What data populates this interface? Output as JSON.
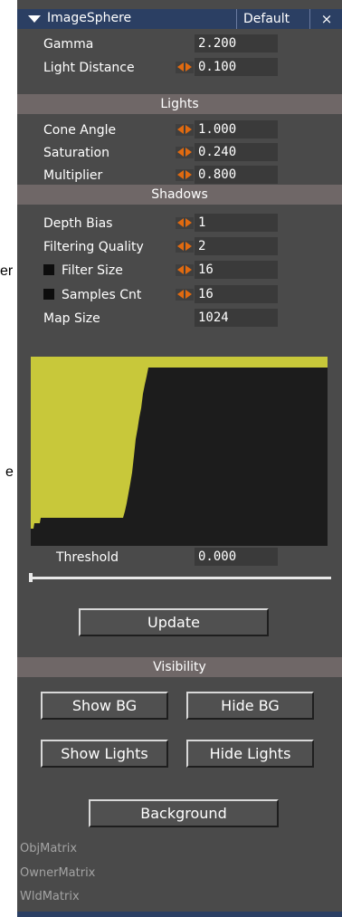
{
  "edge_text": {
    "top": "er",
    "middle": "e"
  },
  "panel": {
    "title": "ImageSphere",
    "preset": "Default",
    "close": "×"
  },
  "params": {
    "gamma": {
      "label": "Gamma",
      "value": "2.200"
    },
    "light_distance": {
      "label": "Light Distance",
      "value": "0.100"
    }
  },
  "lights": {
    "header": "Lights",
    "cone_angle": {
      "label": "Cone Angle",
      "value": "1.000"
    },
    "saturation": {
      "label": "Saturation",
      "value": "0.240"
    },
    "multiplier": {
      "label": "Multiplier",
      "value": "0.800"
    }
  },
  "shadows": {
    "header": "Shadows",
    "depth_bias": {
      "label": "Depth Bias",
      "value": "1"
    },
    "filtering_quality": {
      "label": "Filtering Quality",
      "value": "2"
    },
    "filter_size": {
      "label": "Filter Size",
      "value": "16"
    },
    "samples_cnt": {
      "label": "Samples Cnt",
      "value": "16"
    },
    "map_size": {
      "label": "Map Size",
      "value": "1024"
    }
  },
  "threshold": {
    "label": "Threshold",
    "value": "0.000",
    "slider_fraction": 0
  },
  "buttons": {
    "update": "Update",
    "show_bg": "Show BG",
    "hide_bg": "Hide BG",
    "show_lights": "Show Lights",
    "hide_lights": "Hide Lights",
    "background": "Background"
  },
  "visibility": {
    "header": "Visibility"
  },
  "matrices": [
    "ObjMatrix",
    "OwnerMatrix",
    "WldMatrix"
  ],
  "colors": {
    "panel_bg": "#4a4a4a",
    "title_bar": "#2b3f63",
    "section_header": "#6f6767",
    "spinner_arrows": "#e06a10",
    "graph_fill": "#c8c83a",
    "graph_bg": "#1c1c1c"
  }
}
